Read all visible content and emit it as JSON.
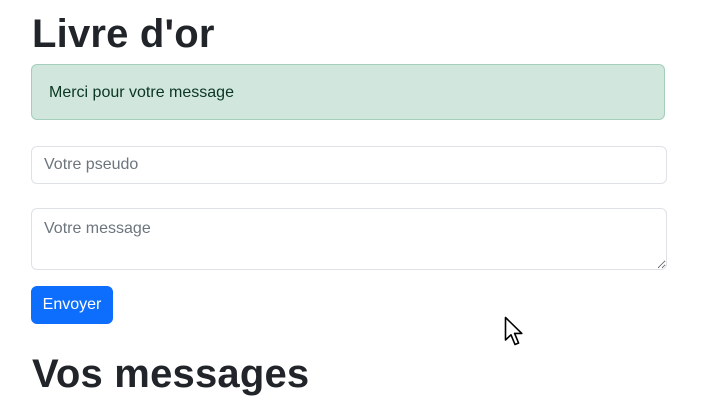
{
  "page": {
    "title": "Livre d'or"
  },
  "alert": {
    "text": "Merci pour votre message",
    "color_bg": "#d1e7dd",
    "color_text": "#0a3622"
  },
  "form": {
    "pseudo": {
      "value": "",
      "placeholder": "Votre pseudo"
    },
    "message": {
      "value": "",
      "placeholder": "Votre message"
    },
    "submit_label": "Envoyer",
    "submit_color": "#0d6efd"
  },
  "messages_section": {
    "title": "Vos messages"
  },
  "icons": {
    "cursor": "mouse-pointer-icon"
  }
}
